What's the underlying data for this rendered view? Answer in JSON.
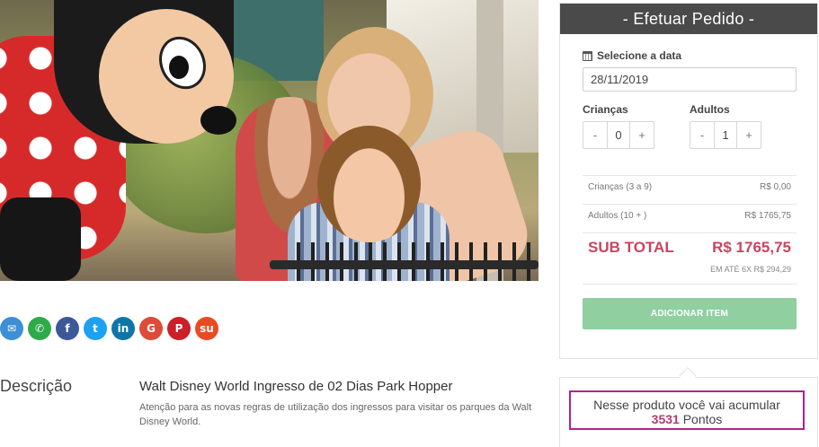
{
  "share": {
    "icons": [
      {
        "name": "email-icon",
        "glyph": "✉",
        "color": "#3d8fd6"
      },
      {
        "name": "whatsapp-icon",
        "glyph": "✆",
        "color": "#2eaa4a"
      },
      {
        "name": "facebook-icon",
        "glyph": "f",
        "color": "#3b5998"
      },
      {
        "name": "twitter-icon",
        "glyph": "t",
        "color": "#1da1f2"
      },
      {
        "name": "linkedin-icon",
        "glyph": "in",
        "color": "#0e76a8"
      },
      {
        "name": "google-icon",
        "glyph": "G",
        "color": "#dd4b39"
      },
      {
        "name": "pinterest-icon",
        "glyph": "P",
        "color": "#cb2027"
      },
      {
        "name": "stumbleupon-icon",
        "glyph": "su",
        "color": "#eb4924"
      }
    ]
  },
  "description": {
    "label": "Descrição",
    "title": "Walt Disney World Ingresso de 02 Dias Park Hopper",
    "text": "Atenção para as novas regras de utilização dos ingressos para visitar os parques da Walt Disney World."
  },
  "order": {
    "title": "- Efetuar Pedido -",
    "date_label": "Selecione a data",
    "date_value": "28/11/2019",
    "children_label": "Crianças",
    "children_value": "0",
    "adults_label": "Adultos",
    "adults_value": "1",
    "minus": "-",
    "plus": "+",
    "lines": [
      {
        "label": "Crianças (3 a 9)",
        "value": "R$ 0,00"
      },
      {
        "label": "Adultos (10 + )",
        "value": "R$ 1765,75"
      }
    ],
    "subtotal_label": "SUB TOTAL",
    "subtotal_value": "R$ 1765,75",
    "installment": "EM ATÉ 6X R$ 294,29",
    "add_button": "ADICIONAR ITEM"
  },
  "points": {
    "line1": "Nesse produto você vai acumular",
    "value": "3531",
    "unit": "Pontos"
  },
  "colors": {
    "header_bg": "#4a4a4a",
    "accent_price": "#c9445e",
    "button_green": "#8fcfa0",
    "points_border": "#b5208c"
  }
}
